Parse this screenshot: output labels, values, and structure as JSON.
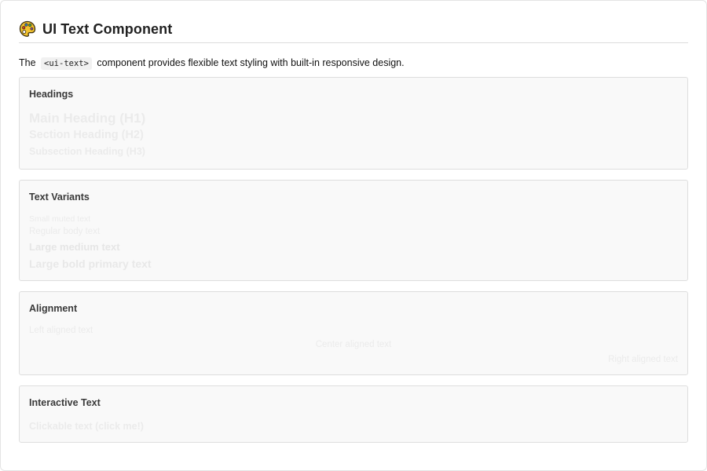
{
  "header": {
    "title": "UI Text Component",
    "icon": "palette-icon"
  },
  "intro": {
    "prefix": "The",
    "code": "<ui-text>",
    "suffix": "component provides flexible text styling with built-in responsive design."
  },
  "sections": {
    "headings": {
      "title": "Headings",
      "h1": "Main Heading (H1)",
      "h2": "Section Heading (H2)",
      "h3": "Subsection Heading (H3)"
    },
    "variants": {
      "title": "Text Variants",
      "small": "Small muted text",
      "body": "Regular body text",
      "large_medium": "Large medium text",
      "large_bold": "Large bold primary text"
    },
    "alignment": {
      "title": "Alignment",
      "left": "Left aligned text",
      "center": "Center aligned text",
      "right": "Right aligned text"
    },
    "interactive": {
      "title": "Interactive Text",
      "clickable": "Clickable text (click me!)"
    }
  },
  "colors": {
    "section_bg": "#f9f9f9",
    "section_border": "#dedede",
    "faint_text": "#ebebeb"
  }
}
